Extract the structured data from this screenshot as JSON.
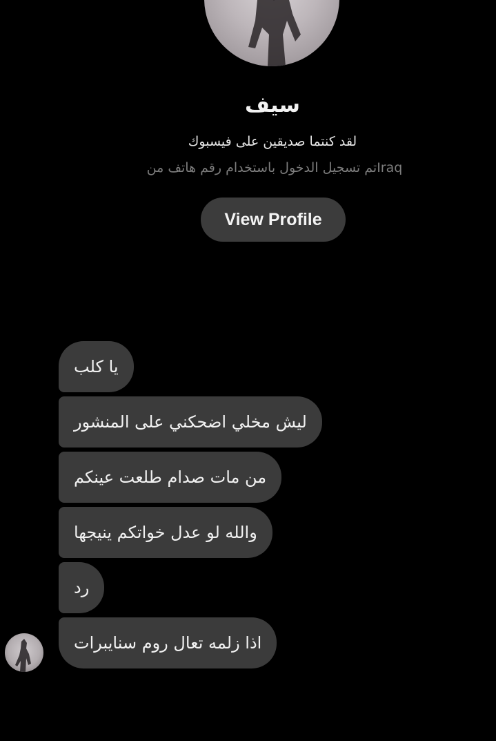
{
  "profile": {
    "name": "سيف",
    "friends_text": "لقد كنتما صديقين على فيسبوك",
    "phone_login_text": "Iraqتم تسجيل الدخول باستخدام رقم هاتف من",
    "view_profile_label": "View Profile"
  },
  "messages": [
    {
      "text": "يا كلب"
    },
    {
      "text": "ليش مخلي اضحكني على المنشور"
    },
    {
      "text": "من مات صدام طلعت عينكم"
    },
    {
      "text": "والله لو عدل خواتكم ينيجها"
    },
    {
      "text": "رد"
    },
    {
      "text": "اذا زلمه تعال روم سنايبرات"
    }
  ],
  "colors": {
    "background": "#000000",
    "bubble": "#3b3b3b",
    "button": "#3c3c3c",
    "muted_text": "#7d7d7d"
  },
  "icons": {
    "profile_avatar": "profile-picture",
    "sender_avatar": "sender-avatar"
  }
}
